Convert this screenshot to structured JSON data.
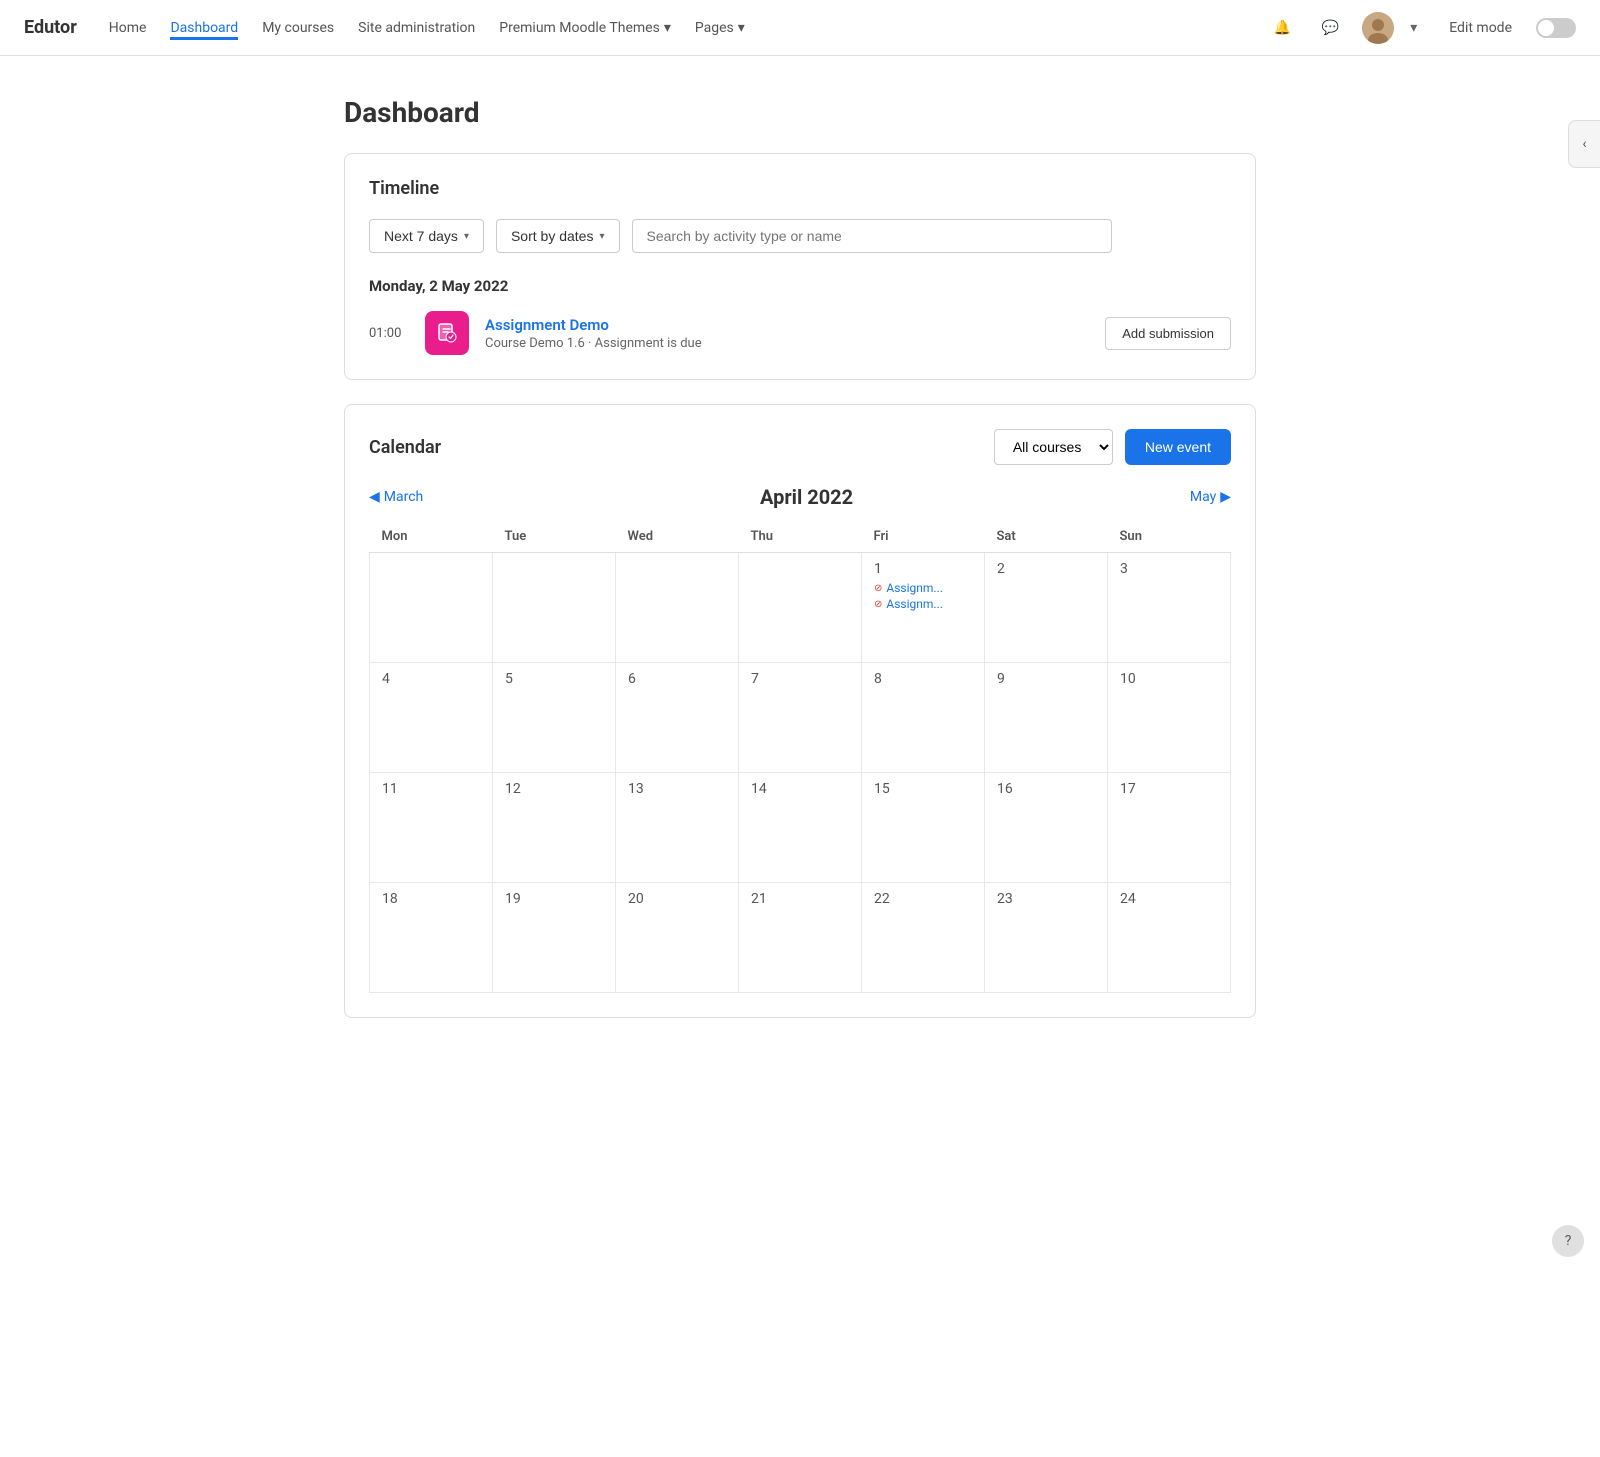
{
  "brand": "Edutor",
  "nav": {
    "items": [
      {
        "label": "Home",
        "active": false
      },
      {
        "label": "Dashboard",
        "active": true
      },
      {
        "label": "My courses",
        "active": false
      },
      {
        "label": "Site administration",
        "active": false
      },
      {
        "label": "Premium Moodle Themes",
        "active": false,
        "dropdown": true
      },
      {
        "label": "Pages",
        "active": false,
        "dropdown": true
      }
    ],
    "edit_mode": "Edit mode"
  },
  "page_title": "Dashboard",
  "timeline": {
    "title": "Timeline",
    "filter_period": "Next 7 days",
    "filter_sort": "Sort by dates",
    "search_placeholder": "Search by activity type or name",
    "date_label": "Monday, 2 May 2022",
    "event": {
      "time": "01:00",
      "name": "Assignment Demo",
      "description": "Course Demo 1.6 · Assignment is due",
      "button_label": "Add submission"
    }
  },
  "calendar": {
    "title": "Calendar",
    "courses_select": "All courses",
    "new_event_btn": "New event",
    "prev_month": "March",
    "next_month": "May",
    "current_month": "April 2022",
    "days_of_week": [
      "Mon",
      "Tue",
      "Wed",
      "Thu",
      "Fri",
      "Sat",
      "Sun"
    ],
    "weeks": [
      [
        {
          "day": "",
          "events": []
        },
        {
          "day": "",
          "events": []
        },
        {
          "day": "",
          "events": []
        },
        {
          "day": "",
          "events": []
        },
        {
          "day": "1",
          "events": [
            {
              "label": "Assignm..."
            },
            {
              "label": "Assignm..."
            }
          ]
        },
        {
          "day": "2",
          "events": []
        },
        {
          "day": "3",
          "events": []
        }
      ],
      [
        {
          "day": "4",
          "events": []
        },
        {
          "day": "5",
          "events": []
        },
        {
          "day": "6",
          "events": []
        },
        {
          "day": "7",
          "events": []
        },
        {
          "day": "8",
          "events": []
        },
        {
          "day": "9",
          "events": []
        },
        {
          "day": "10",
          "events": []
        }
      ],
      [
        {
          "day": "11",
          "events": []
        },
        {
          "day": "12",
          "events": []
        },
        {
          "day": "13",
          "events": []
        },
        {
          "day": "14",
          "events": []
        },
        {
          "day": "15",
          "events": []
        },
        {
          "day": "16",
          "events": []
        },
        {
          "day": "17",
          "events": []
        }
      ],
      [
        {
          "day": "18",
          "events": []
        },
        {
          "day": "19",
          "events": []
        },
        {
          "day": "20",
          "events": []
        },
        {
          "day": "21",
          "events": []
        },
        {
          "day": "22",
          "events": []
        },
        {
          "day": "23",
          "events": []
        },
        {
          "day": "24",
          "events": []
        }
      ]
    ]
  },
  "sidebar_toggle_icon": "‹",
  "help_icon": "?"
}
